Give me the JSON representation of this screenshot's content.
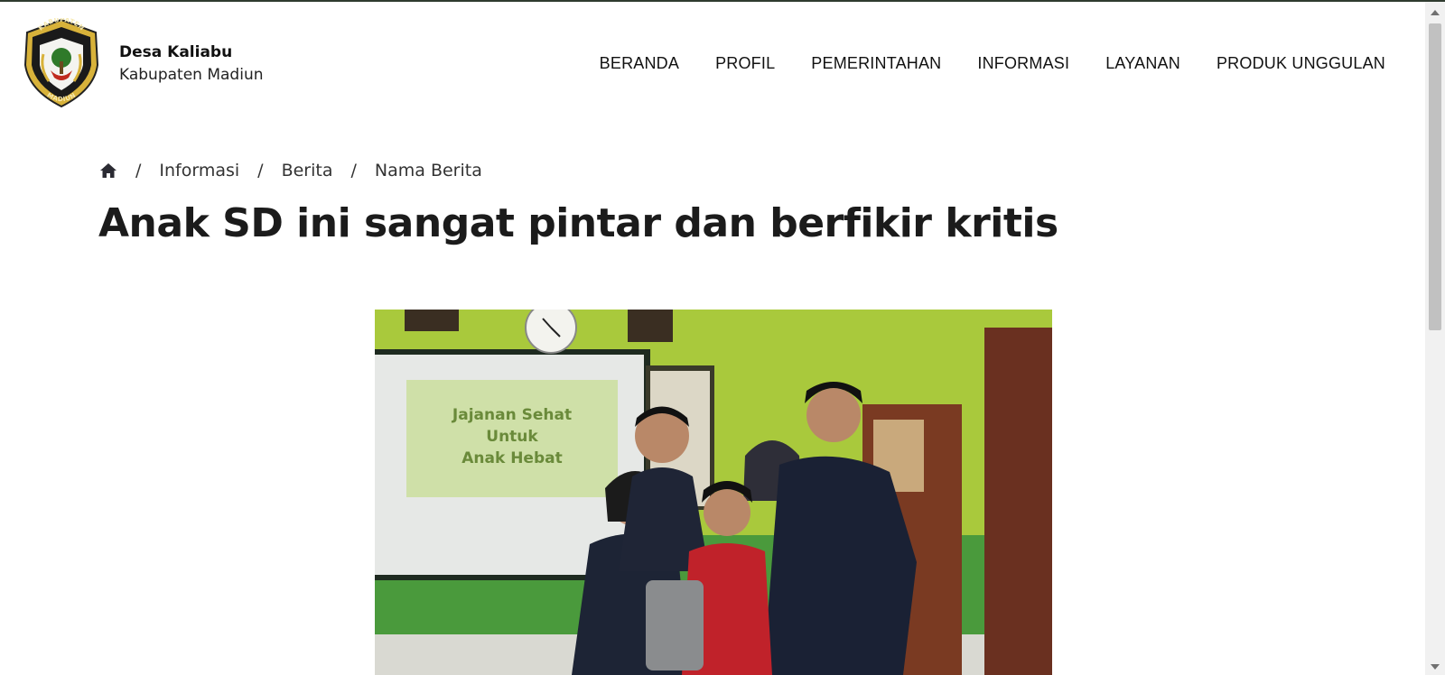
{
  "header": {
    "brand_name": "Desa Kaliabu",
    "brand_sub": "Kabupaten Madiun",
    "logo_text_top": "KABUPATEN",
    "logo_text_bottom": "MADIUN"
  },
  "nav": {
    "items": [
      {
        "label": "BERANDA"
      },
      {
        "label": "PROFIL"
      },
      {
        "label": "PEMERINTAHAN"
      },
      {
        "label": "INFORMASI"
      },
      {
        "label": "LAYANAN"
      },
      {
        "label": "PRODUK UNGGULAN"
      }
    ]
  },
  "breadcrumb": {
    "home_icon": "home-icon",
    "separator": "/",
    "items": [
      {
        "label": "Informasi"
      },
      {
        "label": "Berita"
      },
      {
        "label": "Nama Berita"
      }
    ]
  },
  "article": {
    "title": "Anak SD ini sangat pintar dan berfikir kritis",
    "slide_lines": [
      "Jajanan Sehat",
      "Untuk",
      "Anak Hebat"
    ]
  },
  "colors": {
    "top_strip": "#2f3b2f",
    "wall": "#a8c83a",
    "text": "#1b1b1b"
  }
}
